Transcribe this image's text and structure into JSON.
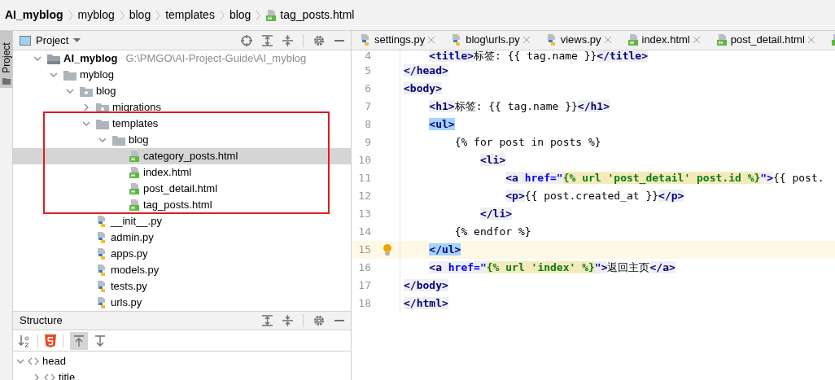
{
  "breadcrumb": [
    {
      "label": "AI_myblog",
      "kind": "plain"
    },
    {
      "label": "myblog",
      "kind": "plain"
    },
    {
      "label": "blog",
      "kind": "plain"
    },
    {
      "label": "templates",
      "kind": "plain"
    },
    {
      "label": "blog",
      "kind": "plain"
    },
    {
      "label": "tag_posts.html",
      "kind": "html"
    }
  ],
  "side_strip": {
    "label": "Project"
  },
  "project_panel": {
    "title": "Project",
    "tree": [
      {
        "label": "AI_myblog",
        "path": "G:\\PMGO\\AI-Project-Guide\\AI_myblog",
        "kind": "project",
        "expanded": true,
        "selected": false,
        "children": [
          {
            "label": "myblog",
            "kind": "folder",
            "expanded": true,
            "selected": false,
            "children": [
              {
                "label": "blog",
                "kind": "package",
                "expanded": true,
                "selected": false,
                "children": [
                  {
                    "label": "migrations",
                    "kind": "package",
                    "expanded": false,
                    "selected": false
                  },
                  {
                    "label": "templates",
                    "kind": "folder",
                    "expanded": true,
                    "selected": false,
                    "children": [
                      {
                        "label": "blog",
                        "kind": "folder",
                        "expanded": true,
                        "selected": false,
                        "children": [
                          {
                            "label": "category_posts.html",
                            "kind": "html",
                            "selected": true
                          },
                          {
                            "label": "index.html",
                            "kind": "html",
                            "selected": false
                          },
                          {
                            "label": "post_detail.html",
                            "kind": "html",
                            "selected": false
                          },
                          {
                            "label": "tag_posts.html",
                            "kind": "html",
                            "selected": false
                          }
                        ]
                      }
                    ]
                  },
                  {
                    "label": "__init__.py",
                    "kind": "python",
                    "selected": false
                  },
                  {
                    "label": "admin.py",
                    "kind": "python",
                    "selected": false
                  },
                  {
                    "label": "apps.py",
                    "kind": "python",
                    "selected": false
                  },
                  {
                    "label": "models.py",
                    "kind": "python",
                    "selected": false
                  },
                  {
                    "label": "tests.py",
                    "kind": "python",
                    "selected": false
                  },
                  {
                    "label": "urls.py",
                    "kind": "python",
                    "selected": false
                  }
                ]
              }
            ]
          }
        ]
      }
    ]
  },
  "structure_panel": {
    "title": "Structure",
    "tree": [
      {
        "label": "head",
        "expanded": true,
        "children": [
          {
            "label": "title",
            "expanded": false
          }
        ]
      }
    ]
  },
  "editor": {
    "tabs": [
      {
        "label": "settings.py",
        "kind": "python"
      },
      {
        "label": "blog\\urls.py",
        "kind": "python"
      },
      {
        "label": "views.py",
        "kind": "python"
      },
      {
        "label": "index.html",
        "kind": "html"
      },
      {
        "label": "post_detail.html",
        "kind": "html"
      },
      {
        "kind": "partial-html"
      }
    ],
    "lines": [
      {
        "number": "4",
        "current": false,
        "segments": [
          {
            "kind": "tag",
            "t": "    <title>"
          },
          {
            "kind": "text",
            "t": "标签: {{ tag.name }}"
          },
          {
            "kind": "tag",
            "t": "</title>"
          }
        ]
      },
      {
        "number": "5",
        "current": false,
        "segments": [
          {
            "kind": "tag",
            "t": "</head>"
          }
        ]
      },
      {
        "number": "6",
        "current": false,
        "segments": [
          {
            "kind": "tag",
            "t": "<body>"
          }
        ]
      },
      {
        "number": "7",
        "current": false,
        "segments": [
          {
            "kind": "tag",
            "t": "    <h1>"
          },
          {
            "kind": "text",
            "t": "标签: {{ tag.name }}"
          },
          {
            "kind": "tag",
            "t": "</h1>"
          }
        ]
      },
      {
        "number": "8",
        "current": false,
        "segments": [
          {
            "kind": "sel",
            "t": "    <ul>"
          }
        ]
      },
      {
        "number": "9",
        "current": false,
        "segments": [
          {
            "kind": "text",
            "t": "        {% for post in posts %}"
          }
        ]
      },
      {
        "number": "10",
        "current": false,
        "segments": [
          {
            "kind": "tag",
            "t": "            <li>"
          }
        ]
      },
      {
        "number": "11",
        "current": false,
        "segments": [
          {
            "kind": "tag",
            "t": "                <a "
          },
          {
            "kind": "attr",
            "t": "href=\""
          },
          {
            "kind": "tmpl",
            "t": "{% url 'post_detail' post.id %}"
          },
          {
            "kind": "attr",
            "t": "\""
          },
          {
            "kind": "tag",
            "t": ">"
          },
          {
            "kind": "text",
            "t": "{{ post."
          }
        ]
      },
      {
        "number": "12",
        "current": false,
        "segments": [
          {
            "kind": "tag",
            "t": "                <p>"
          },
          {
            "kind": "text",
            "t": "{{ post.created_at }}"
          },
          {
            "kind": "tag",
            "t": "</p>"
          }
        ]
      },
      {
        "number": "13",
        "current": false,
        "segments": [
          {
            "kind": "tag",
            "t": "            </li>"
          }
        ]
      },
      {
        "number": "14",
        "current": false,
        "segments": [
          {
            "kind": "text",
            "t": "        {% endfor %}"
          }
        ]
      },
      {
        "number": "15",
        "current": true,
        "segments": [
          {
            "kind": "sel",
            "t": "    </ul>"
          }
        ]
      },
      {
        "number": "16",
        "current": false,
        "segments": [
          {
            "kind": "tag",
            "t": "    <a "
          },
          {
            "kind": "attr",
            "t": "href=\""
          },
          {
            "kind": "tmpl",
            "t": "{% url 'index' %}"
          },
          {
            "kind": "attr",
            "t": "\""
          },
          {
            "kind": "tag",
            "t": ">"
          },
          {
            "kind": "text",
            "t": "返回主页"
          },
          {
            "kind": "tag",
            "t": "</a>"
          }
        ]
      },
      {
        "number": "17",
        "current": false,
        "segments": [
          {
            "kind": "tag",
            "t": "</body>"
          }
        ]
      },
      {
        "number": "18",
        "current": false,
        "segments": [
          {
            "kind": "tag",
            "t": "</html>"
          }
        ]
      }
    ]
  }
}
